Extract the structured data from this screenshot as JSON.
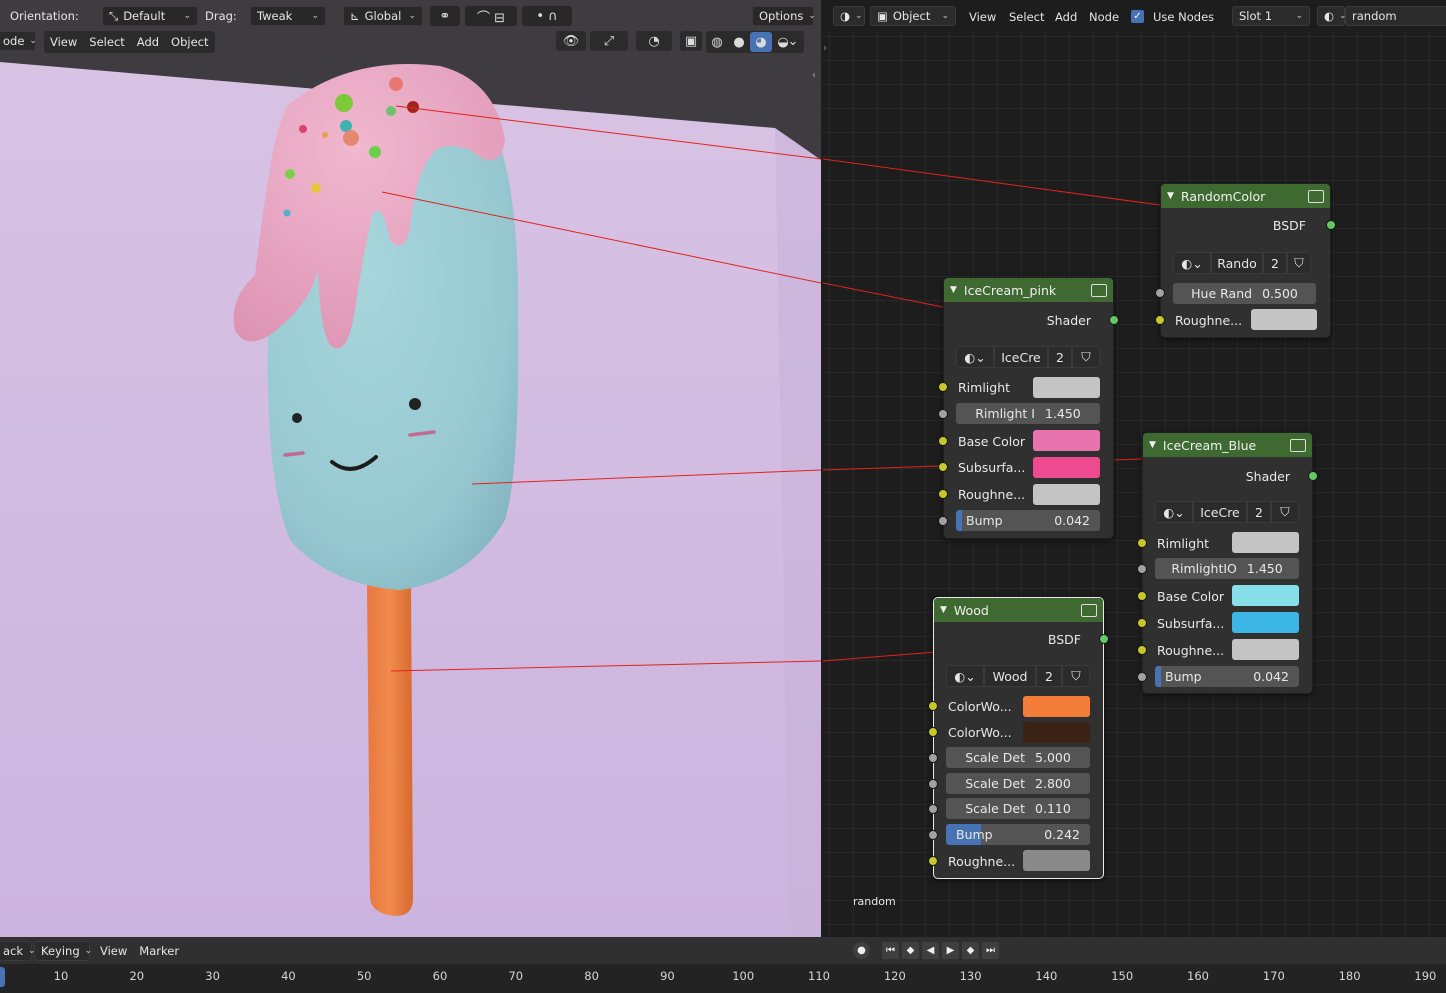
{
  "viewport_header": {
    "orientation_label": "Orientation:",
    "orientation_value": "Default",
    "drag_label": "Drag:",
    "drag_value": "Tweak",
    "transform_value": "Global",
    "options_label": "Options",
    "mode_value": "ode",
    "menus": [
      "View",
      "Select",
      "Add",
      "Object"
    ]
  },
  "node_header": {
    "object_type": "Object",
    "menus": [
      "View",
      "Select",
      "Add",
      "Node"
    ],
    "use_nodes_label": "Use Nodes",
    "use_nodes_checked": true,
    "slot_value": "Slot 1",
    "material_name": "random"
  },
  "frame_label": "random",
  "nodes": {
    "random_color": {
      "title": "RandomColor",
      "output": "BSDF",
      "material_short": "Rando",
      "users": "2",
      "hue_label": "Hue Rand",
      "hue_value": "0.500",
      "roughness_label": "Roughne...",
      "roughness_color": "#c4c4c4"
    },
    "icecream_pink": {
      "title": "IceCream_pink",
      "output": "Shader",
      "material_short": "IceCre",
      "users": "2",
      "rimlight_label": "Rimlight",
      "rimlight_color": "#c4c4c4",
      "rimlight_ior_label": "Rimlight I",
      "rimlight_ior_value": "1.450",
      "base_color_label": "Base Color",
      "base_color": "#e874ad",
      "subsurface_label": "Subsurfa...",
      "subsurface_color": "#ee4a8f",
      "roughness_label": "Roughne...",
      "roughness_color": "#c4c4c4",
      "bump_label": "Bump",
      "bump_value": "0.042",
      "bump_fraction": 0.042
    },
    "icecream_blue": {
      "title": "IceCream_Blue",
      "output": "Shader",
      "material_short": "IceCre",
      "users": "2",
      "rimlight_label": "Rimlight",
      "rimlight_color": "#c4c4c4",
      "rimlight_ior_label": "RimlightIO",
      "rimlight_ior_value": "1.450",
      "base_color_label": "Base Color",
      "base_color": "#86dfe9",
      "subsurface_label": "Subsurfa...",
      "subsurface_color": "#3bb6e6",
      "roughness_label": "Roughne...",
      "roughness_color": "#c4c4c4",
      "bump_label": "Bump",
      "bump_value": "0.042",
      "bump_fraction": 0.042
    },
    "wood": {
      "title": "Wood",
      "output": "BSDF",
      "material_short": "Wood",
      "users": "2",
      "color_wood1_label": "ColorWo...",
      "color_wood1": "#f47e39",
      "color_wood2_label": "ColorWo...",
      "color_wood2": "#3a2314",
      "scale1_label": "Scale Det",
      "scale1_value": "5.000",
      "scale2_label": "Scale Det",
      "scale2_value": "2.800",
      "scale3_label": "Scale Det",
      "scale3_value": "0.110",
      "bump_label": "Bump",
      "bump_value": "0.242",
      "bump_fraction": 0.242,
      "roughness_label": "Roughne...",
      "roughness_color": "#8a8a8a"
    }
  },
  "timeline": {
    "menus": [
      "ack",
      "Keying",
      "View",
      "Marker"
    ],
    "ticks": [
      "10",
      "20",
      "30",
      "40",
      "50",
      "60",
      "70",
      "80",
      "90",
      "100",
      "110",
      "120",
      "130",
      "140",
      "150",
      "160",
      "170",
      "180",
      "190"
    ]
  },
  "colors": {
    "node_header": "#3e6a32",
    "socket_yellow": "#c7c729",
    "socket_green": "#63c763",
    "annotation_line": "#e0231b",
    "backdrop": "#d2bde0"
  }
}
